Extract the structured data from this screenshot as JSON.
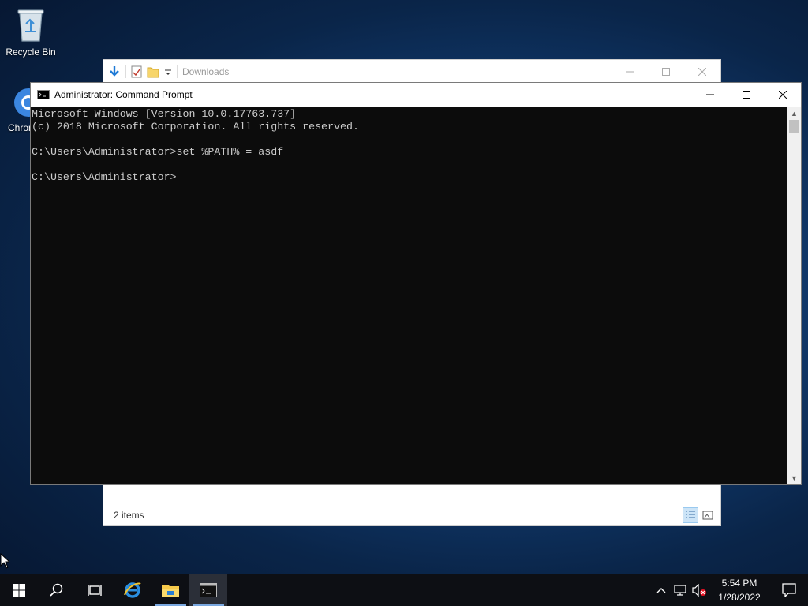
{
  "desktop": {
    "icons": [
      {
        "label": "Recycle Bin"
      },
      {
        "label": "Chrome"
      }
    ]
  },
  "explorer": {
    "title": "Downloads",
    "status": "2 items"
  },
  "cmd": {
    "title": "Administrator: Command Prompt",
    "lines": [
      "Microsoft Windows [Version 10.0.17763.737]",
      "(c) 2018 Microsoft Corporation. All rights reserved.",
      "",
      "C:\\Users\\Administrator>set %PATH% = asdf",
      "",
      "C:\\Users\\Administrator>"
    ]
  },
  "taskbar": {
    "time": "5:54 PM",
    "date": "1/28/2022"
  },
  "colors": {
    "console_bg": "#0c0c0c",
    "console_fg": "#cccccc",
    "taskbar_bg": "#0d0f14",
    "accent": "#7aa8e0"
  }
}
